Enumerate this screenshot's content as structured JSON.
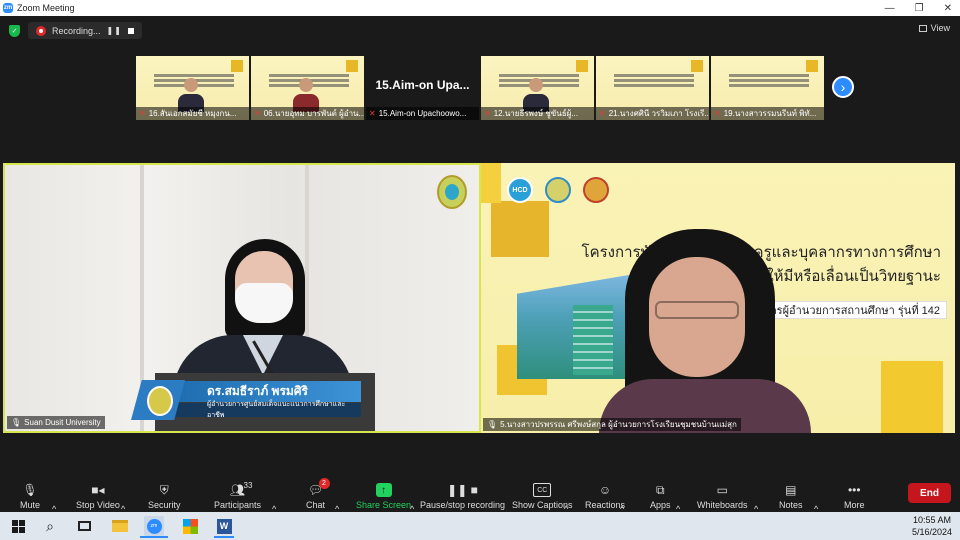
{
  "window": {
    "title": "Zoom Meeting",
    "app_icon_text": "zm"
  },
  "recording": {
    "label": "Recording..."
  },
  "view_label": "View",
  "thumbnails": [
    {
      "label": "16.สันเอกสมัยชี หมุงกน..."
    },
    {
      "label": "06.นายอุทม บารพันต์ ผู้อำน..."
    },
    {
      "label": "15.Aim-on Upachoowo...",
      "display_name": "15.Aim-on  Upa..."
    },
    {
      "label": "12.นายธีรพงษ์ ชูขันธ์ผู้..."
    },
    {
      "label": "21.นางศศินี วรวิมเภา โรงเรี..."
    },
    {
      "label": "19.นางสาวรรมนรีนท์ พิทั..."
    }
  ],
  "next_button": "›",
  "speaker_tile": {
    "name_plate_title": "ดร.สมธีราภ์ พรมศิริ",
    "name_plate_subtitle": "ผู้อำนวยการศูนย์สมเด็จแนะแนวการศึกษาและอาชีพ",
    "label": "Suan Dusit University"
  },
  "presenter_tile": {
    "logo_text": "HCD",
    "headline_lines": [
      "โครงการพัฒนาข้าราชการครูและบุคลากรทางการศึกษา",
      "ก่อนแต่งตั้งให้มีหรือเลื่อนเป็นวิทยฐานะ"
    ],
    "subline": "หลักสูตรผู้อำนวยการสถานศึกษา รุ่นที่ 142",
    "label": "5.นางสาวปรพรรณ ศรีพงษ์สกุล ผู้อำนวยการโรงเรียนชุมชนบ้านแม่สุก"
  },
  "toolbar": {
    "mute": "Mute",
    "stop_video": "Stop Video",
    "security": "Security",
    "participants": "Participants",
    "participants_count": "33",
    "chat": "Chat",
    "chat_badge": "2",
    "share_screen": "Share Screen",
    "pause_recording": "Pause/stop recording",
    "captions": "Show Captions",
    "captions_icon": "CC",
    "reactions": "Reactions",
    "apps": "Apps",
    "whiteboards": "Whiteboards",
    "notes": "Notes",
    "more": "More",
    "end": "End"
  },
  "taskbar": {
    "time": "10:55 AM",
    "date": "5/16/2024",
    "word_icon": "W"
  },
  "colors": {
    "accent": "#2d8cff",
    "end": "#c4161c",
    "share": "#23d160",
    "active_speaker": "#d7e64a"
  }
}
